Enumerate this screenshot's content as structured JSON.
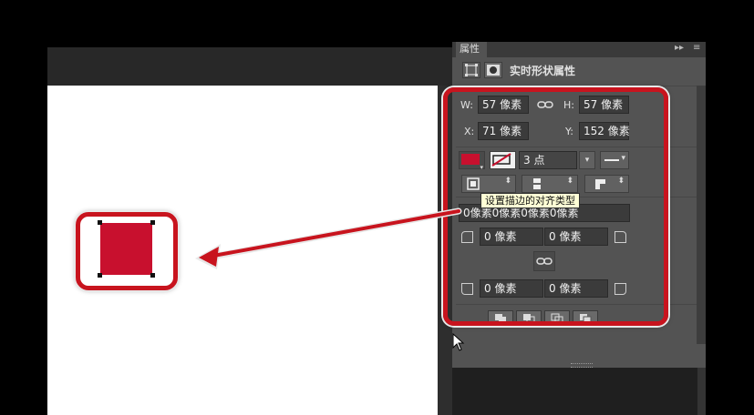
{
  "panel": {
    "tab_label": "属性",
    "header_title": "实时形状属性",
    "size": {
      "w_label": "W:",
      "w_value": "57 像素",
      "h_label": "H:",
      "h_value": "57 像素"
    },
    "position": {
      "x_label": "X:",
      "x_value": "71 像素",
      "y_label": "Y:",
      "y_value": "152 像素"
    },
    "stroke": {
      "fill_color": "#c8102e",
      "width_value": "3 点"
    },
    "tooltip": "设置描边的对齐类型",
    "corner_radii": {
      "summary": "0像素0像素0像素0像素",
      "top_left": "0 像素",
      "top_right": "0 像素",
      "bottom_left": "0 像素",
      "bottom_right": "0 像素"
    }
  },
  "colors": {
    "highlight": "#c8141e",
    "shape_fill": "#c8102e",
    "panel_bg": "#535353"
  }
}
